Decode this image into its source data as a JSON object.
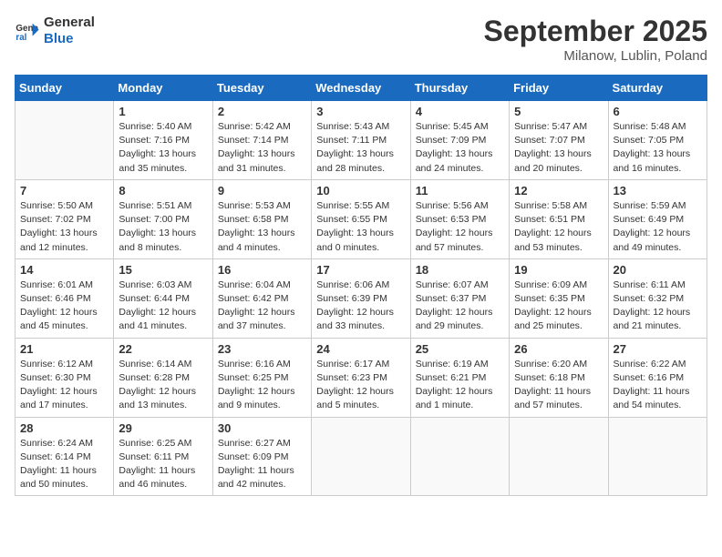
{
  "header": {
    "logo_line1": "General",
    "logo_line2": "Blue",
    "month_title": "September 2025",
    "location": "Milanow, Lublin, Poland"
  },
  "weekdays": [
    "Sunday",
    "Monday",
    "Tuesday",
    "Wednesday",
    "Thursday",
    "Friday",
    "Saturday"
  ],
  "weeks": [
    [
      {
        "day": "",
        "info": ""
      },
      {
        "day": "1",
        "info": "Sunrise: 5:40 AM\nSunset: 7:16 PM\nDaylight: 13 hours\nand 35 minutes."
      },
      {
        "day": "2",
        "info": "Sunrise: 5:42 AM\nSunset: 7:14 PM\nDaylight: 13 hours\nand 31 minutes."
      },
      {
        "day": "3",
        "info": "Sunrise: 5:43 AM\nSunset: 7:11 PM\nDaylight: 13 hours\nand 28 minutes."
      },
      {
        "day": "4",
        "info": "Sunrise: 5:45 AM\nSunset: 7:09 PM\nDaylight: 13 hours\nand 24 minutes."
      },
      {
        "day": "5",
        "info": "Sunrise: 5:47 AM\nSunset: 7:07 PM\nDaylight: 13 hours\nand 20 minutes."
      },
      {
        "day": "6",
        "info": "Sunrise: 5:48 AM\nSunset: 7:05 PM\nDaylight: 13 hours\nand 16 minutes."
      }
    ],
    [
      {
        "day": "7",
        "info": "Sunrise: 5:50 AM\nSunset: 7:02 PM\nDaylight: 13 hours\nand 12 minutes."
      },
      {
        "day": "8",
        "info": "Sunrise: 5:51 AM\nSunset: 7:00 PM\nDaylight: 13 hours\nand 8 minutes."
      },
      {
        "day": "9",
        "info": "Sunrise: 5:53 AM\nSunset: 6:58 PM\nDaylight: 13 hours\nand 4 minutes."
      },
      {
        "day": "10",
        "info": "Sunrise: 5:55 AM\nSunset: 6:55 PM\nDaylight: 13 hours\nand 0 minutes."
      },
      {
        "day": "11",
        "info": "Sunrise: 5:56 AM\nSunset: 6:53 PM\nDaylight: 12 hours\nand 57 minutes."
      },
      {
        "day": "12",
        "info": "Sunrise: 5:58 AM\nSunset: 6:51 PM\nDaylight: 12 hours\nand 53 minutes."
      },
      {
        "day": "13",
        "info": "Sunrise: 5:59 AM\nSunset: 6:49 PM\nDaylight: 12 hours\nand 49 minutes."
      }
    ],
    [
      {
        "day": "14",
        "info": "Sunrise: 6:01 AM\nSunset: 6:46 PM\nDaylight: 12 hours\nand 45 minutes."
      },
      {
        "day": "15",
        "info": "Sunrise: 6:03 AM\nSunset: 6:44 PM\nDaylight: 12 hours\nand 41 minutes."
      },
      {
        "day": "16",
        "info": "Sunrise: 6:04 AM\nSunset: 6:42 PM\nDaylight: 12 hours\nand 37 minutes."
      },
      {
        "day": "17",
        "info": "Sunrise: 6:06 AM\nSunset: 6:39 PM\nDaylight: 12 hours\nand 33 minutes."
      },
      {
        "day": "18",
        "info": "Sunrise: 6:07 AM\nSunset: 6:37 PM\nDaylight: 12 hours\nand 29 minutes."
      },
      {
        "day": "19",
        "info": "Sunrise: 6:09 AM\nSunset: 6:35 PM\nDaylight: 12 hours\nand 25 minutes."
      },
      {
        "day": "20",
        "info": "Sunrise: 6:11 AM\nSunset: 6:32 PM\nDaylight: 12 hours\nand 21 minutes."
      }
    ],
    [
      {
        "day": "21",
        "info": "Sunrise: 6:12 AM\nSunset: 6:30 PM\nDaylight: 12 hours\nand 17 minutes."
      },
      {
        "day": "22",
        "info": "Sunrise: 6:14 AM\nSunset: 6:28 PM\nDaylight: 12 hours\nand 13 minutes."
      },
      {
        "day": "23",
        "info": "Sunrise: 6:16 AM\nSunset: 6:25 PM\nDaylight: 12 hours\nand 9 minutes."
      },
      {
        "day": "24",
        "info": "Sunrise: 6:17 AM\nSunset: 6:23 PM\nDaylight: 12 hours\nand 5 minutes."
      },
      {
        "day": "25",
        "info": "Sunrise: 6:19 AM\nSunset: 6:21 PM\nDaylight: 12 hours\nand 1 minute."
      },
      {
        "day": "26",
        "info": "Sunrise: 6:20 AM\nSunset: 6:18 PM\nDaylight: 11 hours\nand 57 minutes."
      },
      {
        "day": "27",
        "info": "Sunrise: 6:22 AM\nSunset: 6:16 PM\nDaylight: 11 hours\nand 54 minutes."
      }
    ],
    [
      {
        "day": "28",
        "info": "Sunrise: 6:24 AM\nSunset: 6:14 PM\nDaylight: 11 hours\nand 50 minutes."
      },
      {
        "day": "29",
        "info": "Sunrise: 6:25 AM\nSunset: 6:11 PM\nDaylight: 11 hours\nand 46 minutes."
      },
      {
        "day": "30",
        "info": "Sunrise: 6:27 AM\nSunset: 6:09 PM\nDaylight: 11 hours\nand 42 minutes."
      },
      {
        "day": "",
        "info": ""
      },
      {
        "day": "",
        "info": ""
      },
      {
        "day": "",
        "info": ""
      },
      {
        "day": "",
        "info": ""
      }
    ]
  ]
}
